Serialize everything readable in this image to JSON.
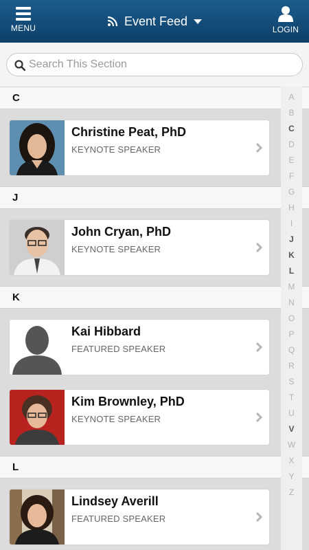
{
  "header": {
    "menu_label": "MENU",
    "title": "Event Feed",
    "login_label": "LOGIN",
    "title_icon": "rss-icon",
    "bg_color": "#1d5c8e"
  },
  "search": {
    "placeholder": "Search This Section"
  },
  "sections": [
    {
      "letter": "C",
      "items": [
        {
          "name": "Christine Peat, PhD",
          "role": "KEYNOTE SPEAKER"
        }
      ]
    },
    {
      "letter": "J",
      "items": [
        {
          "name": "John Cryan, PhD",
          "role": "KEYNOTE SPEAKER"
        }
      ]
    },
    {
      "letter": "K",
      "items": [
        {
          "name": "Kai Hibbard",
          "role": "FEATURED SPEAKER"
        },
        {
          "name": "Kim Brownley, PhD",
          "role": "KEYNOTE SPEAKER"
        }
      ]
    },
    {
      "letter": "L",
      "items": [
        {
          "name": "Lindsey Averill",
          "role": "FEATURED SPEAKER"
        }
      ]
    }
  ],
  "alphabet": [
    "A",
    "B",
    "C",
    "D",
    "E",
    "F",
    "G",
    "H",
    "I",
    "J",
    "K",
    "L",
    "M",
    "N",
    "O",
    "P",
    "Q",
    "R",
    "S",
    "T",
    "U",
    "V",
    "W",
    "X",
    "Y",
    "Z"
  ],
  "alphabet_active": [
    "C",
    "J",
    "K",
    "L",
    "V"
  ]
}
